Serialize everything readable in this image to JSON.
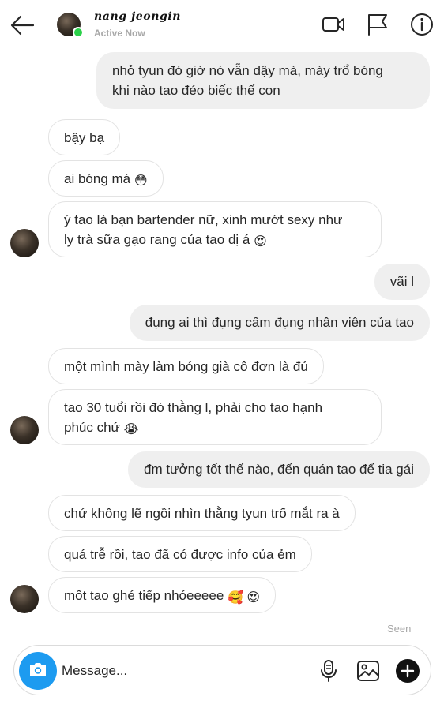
{
  "header": {
    "username": "nang jeongin",
    "status": "Active Now"
  },
  "messages": [
    {
      "side": "out",
      "text": "nhỏ tyun đó giờ nó vẫn dậy mà, mày trổ bóng\nkhi nào tao đéo biếc thế con"
    },
    {
      "side": "in",
      "text": "bậy bạ"
    },
    {
      "side": "in",
      "text": "ai bóng má",
      "emoji": "😳"
    },
    {
      "side": "in",
      "text": "ý tao là bạn bartender nữ, xinh mướt sexy như\nly trà sữa gạo rang của tao dị á",
      "emoji": "😍"
    },
    {
      "side": "out",
      "text": "vãi l"
    },
    {
      "side": "out",
      "text": "đụng ai thì đụng cấm đụng nhân viên của tao"
    },
    {
      "side": "in",
      "text": "một mình mày làm bóng già cô đơn là đủ"
    },
    {
      "side": "in",
      "text": "tao 30 tuổi rồi đó thằng l, phải cho tao hạnh\nphúc chứ",
      "emoji": "😭"
    },
    {
      "side": "out",
      "text": "đm tưởng tốt thế nào, đến quán tao để tia gái"
    },
    {
      "side": "in",
      "text": "chứ không lẽ ngồi nhìn thằng tyun trố mắt ra à"
    },
    {
      "side": "in",
      "text": "quá trễ rồi, tao đã có được info của ẻm"
    },
    {
      "side": "in",
      "text": "mốt tao ghé tiếp nhóeeeee",
      "emoji": "🥰 😍"
    }
  ],
  "seen_label": "Seen",
  "composer": {
    "placeholder": "Message..."
  },
  "colors": {
    "online": "#2bd14a",
    "camera_button": "#1d9bf0",
    "outgoing_bubble": "#efefef",
    "incoming_border": "#e3e3e3"
  }
}
